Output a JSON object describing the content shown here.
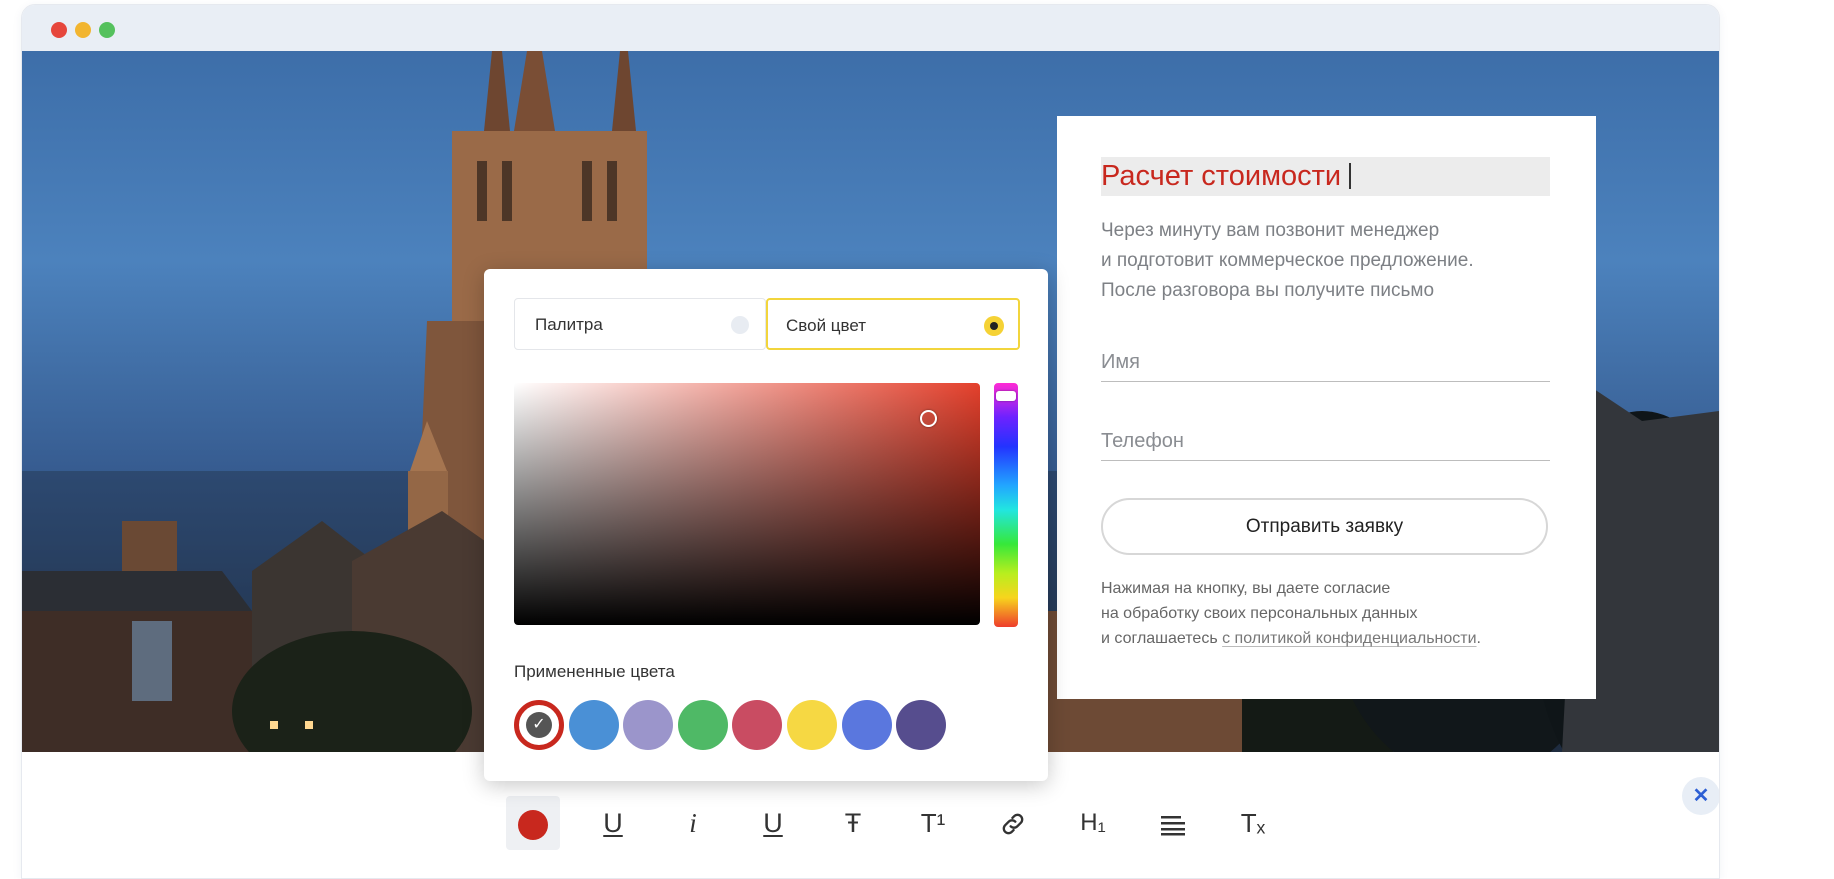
{
  "window": {
    "traffic_lights": [
      "#e6463c",
      "#f2b530",
      "#55c15d"
    ]
  },
  "form_card": {
    "title": "Расчет стоимости",
    "subtitle_lines": [
      "Через минуту вам позвонит менеджер",
      "и подготовит коммерческое предложение.",
      "После разговора вы получите письмо"
    ],
    "name_placeholder": "Имя",
    "phone_placeholder": "Телефон",
    "submit_label": "Отправить заявку",
    "consent_line1": "Нажимая на кнопку, вы даете согласие",
    "consent_line2": "на обработку своих персональных данных",
    "consent_line3_prefix": "и соглашаетесь ",
    "consent_link": "с политикой конфиденциальности",
    "consent_suffix": "."
  },
  "color_picker": {
    "tabs": [
      {
        "label": "Палитра",
        "selected": false
      },
      {
        "label": "Свой цвет",
        "selected": true
      }
    ],
    "current_hue_color": "#e4402c",
    "applied_colors_label": "Примененные цвета",
    "applied_colors": [
      "#c8281e",
      "#4a90d6",
      "#9b95cb",
      "#4fb966",
      "#c94c62",
      "#f6d843",
      "#5a77de",
      "#564d8e"
    ],
    "selected_color_index": 0
  },
  "toolbar": {
    "active_color": "#c8281e",
    "buttons": [
      {
        "name": "text-color-button",
        "icon": "color-dot-icon"
      },
      {
        "name": "underline-button",
        "icon": "underline-icon"
      },
      {
        "name": "italic-button",
        "icon": "italic-icon"
      },
      {
        "name": "underline-alt-button",
        "icon": "underline-icon"
      },
      {
        "name": "strikethrough-button",
        "icon": "strikethrough-icon"
      },
      {
        "name": "superscript-button",
        "icon": "superscript-icon"
      },
      {
        "name": "link-button",
        "icon": "link-icon"
      },
      {
        "name": "heading-button",
        "icon": "heading-icon"
      },
      {
        "name": "align-button",
        "icon": "align-left-icon"
      },
      {
        "name": "clear-format-button",
        "icon": "clear-format-icon"
      }
    ],
    "close_icon": "close-icon"
  }
}
